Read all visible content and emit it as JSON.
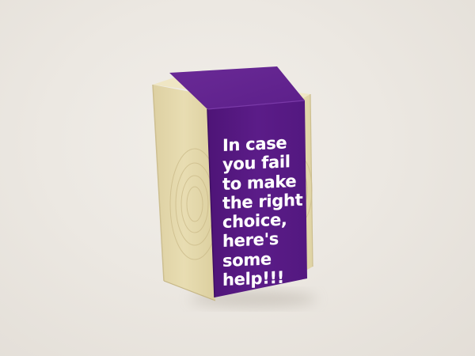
{
  "photo": {
    "subject": "wooden-block-with-purple-band",
    "background_color": "#ece8e2",
    "wood_color": "#e5d9aa",
    "band_color": "#5a1a86"
  },
  "band": {
    "lines": [
      "In case",
      "you fail",
      "to make",
      "the right",
      "choice,",
      "here's",
      "some",
      "help!!!"
    ]
  }
}
